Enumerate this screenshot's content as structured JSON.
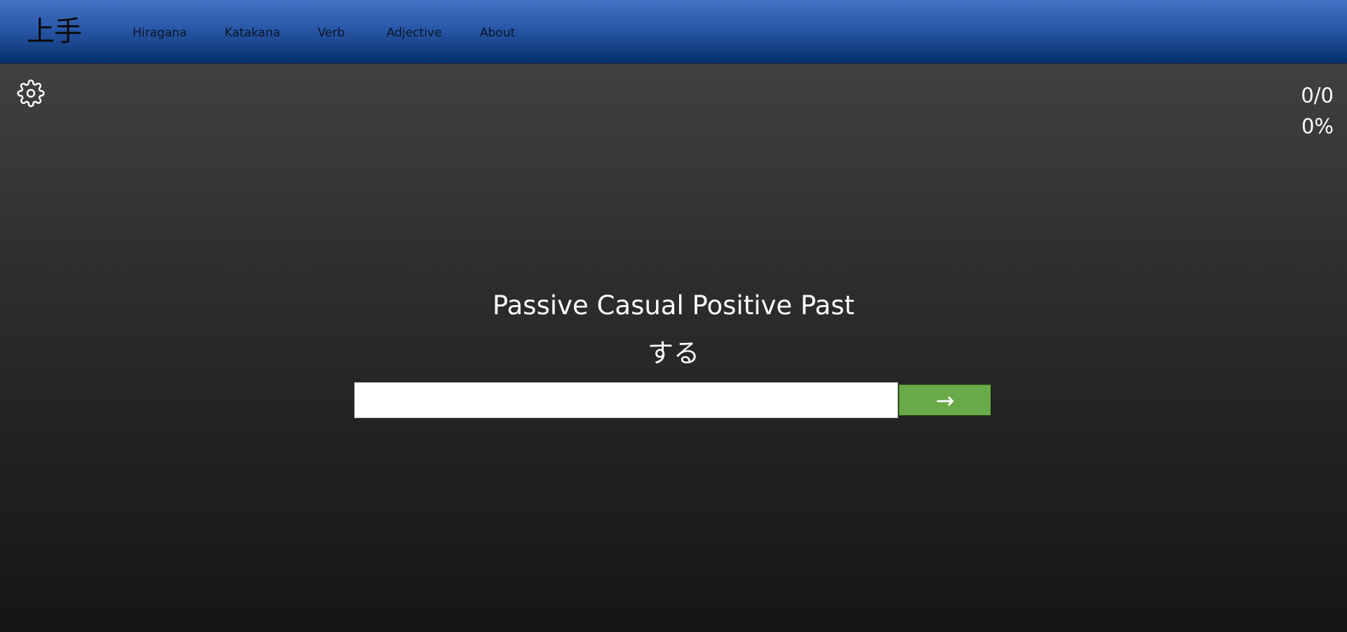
{
  "nav": {
    "logo": "上手",
    "links": [
      "Hiragana",
      "Katakana",
      "Verb",
      "Adjective",
      "About"
    ]
  },
  "settings": {
    "icon": "gear-icon"
  },
  "score": {
    "count": "0/0",
    "percent": "0%"
  },
  "quiz": {
    "prompt": "Passive Casual Positive Past",
    "word": "する",
    "answer_value": "",
    "answer_placeholder": "",
    "submit_label": "→"
  },
  "colors": {
    "nav_top": "#4472c4",
    "nav_bottom": "#04306a",
    "background_top": "#464646",
    "background_bottom": "#151515",
    "submit_green": "#6aaa48"
  }
}
